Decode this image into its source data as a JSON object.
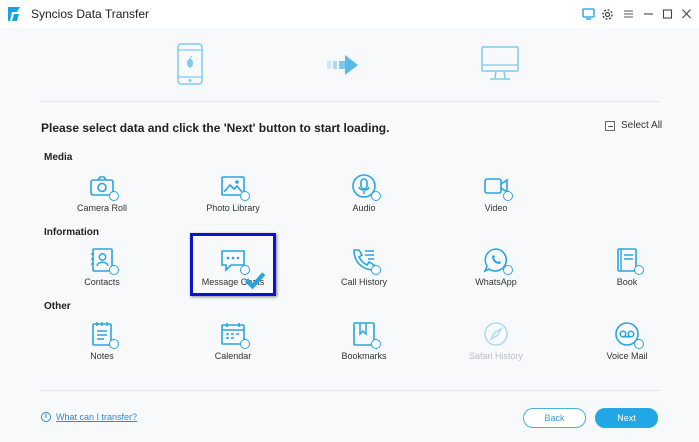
{
  "app": {
    "title": "Syncios Data Transfer"
  },
  "instruction": "Please select data and click the 'Next' button to start loading.",
  "select_all": "Select All",
  "sections": {
    "media": "Media",
    "information": "Information",
    "other": "Other"
  },
  "items": {
    "camera_roll": "Camera Roll",
    "photo_library": "Photo Library",
    "audio": "Audio",
    "video": "Video",
    "contacts": "Contacts",
    "message_chats": "Message Chats",
    "call_history": "Call History",
    "whatsapp": "WhatsApp",
    "book": "Book",
    "notes": "Notes",
    "calendar": "Calendar",
    "bookmarks": "Bookmarks",
    "safari_history": "Safari History",
    "voice_mail": "Voice Mail"
  },
  "footer": {
    "help_link": "What can I transfer?",
    "back": "Back",
    "next": "Next"
  },
  "colors": {
    "accent": "#22a7e6",
    "icon": "#29a6dd",
    "highlight": "#0b12d4"
  }
}
